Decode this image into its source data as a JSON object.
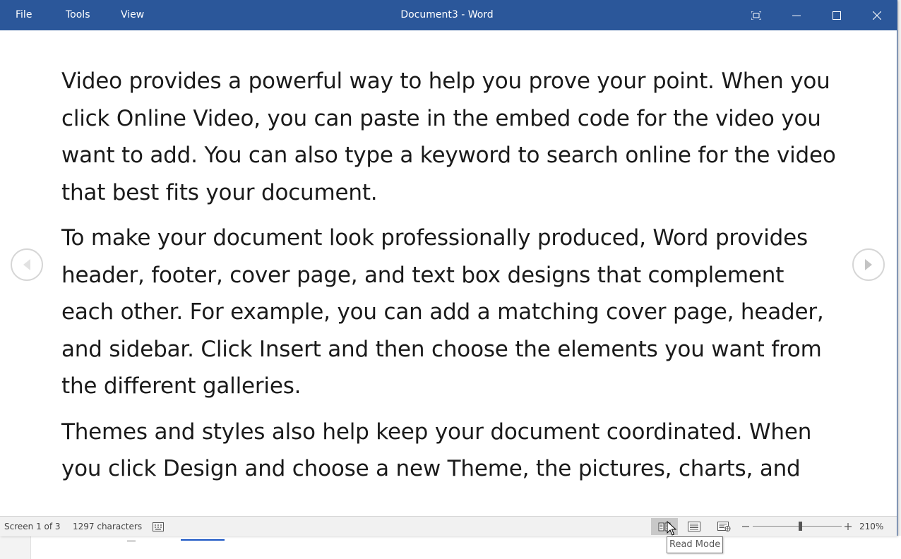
{
  "app": {
    "title": "Document3  -  Word",
    "menu": [
      "File",
      "Tools",
      "View"
    ]
  },
  "window_controls": {
    "fullscreen_icon": "restore-fullscreen-icon",
    "minimize_icon": "minimize-icon",
    "maximize_icon": "maximize-icon",
    "close_icon": "close-icon"
  },
  "document": {
    "paragraphs": [
      "Video provides a powerful way to help you prove your point. When you click Online Video, you can paste in the embed code for the video you want to add. You can also type a keyword to search online for the video that best fits your document.",
      "To make your document look professionally produced, Word provides header, footer, cover page, and text box designs that complement each other. For example, you can add a matching cover page, header, and sidebar. Click Insert and then choose the elements you want from the different galleries.",
      "Themes and styles also help keep your document coordinated. When you click Design and choose a new Theme, the pictures, charts, and"
    ]
  },
  "navigation": {
    "prev_icon": "chevron-left-icon",
    "next_icon": "chevron-right-icon"
  },
  "status": {
    "screen": "Screen 1 of 3",
    "characters": "1297 characters",
    "zoom": "210%",
    "zoom_fraction": 0.52,
    "active_view": "Read Mode"
  },
  "tooltip": {
    "text": "Read Mode"
  },
  "colors": {
    "titlebar": "#2b579a",
    "statusbar": "#f1f1f1"
  }
}
